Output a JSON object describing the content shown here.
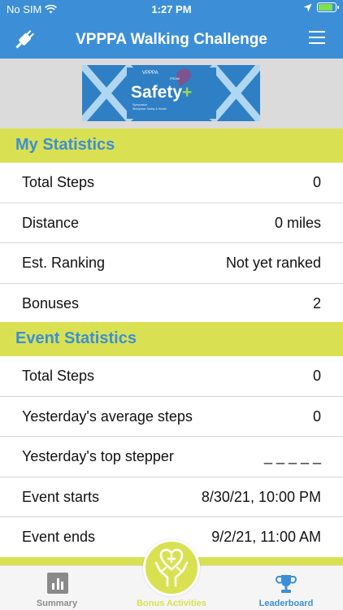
{
  "status_bar": {
    "carrier": "No SIM",
    "time": "1:27 PM",
    "battery_level": 0.92,
    "icons": [
      "wifi-icon",
      "location-arrow-icon",
      "battery-charging-icon"
    ]
  },
  "nav": {
    "title": "VPPPA Walking Challenge",
    "left_icon": "plug-icon",
    "right_icon": "hamburger-menu-icon"
  },
  "banner": {
    "org": "VPPPA",
    "from": "FROM",
    "title": "Safety",
    "title_plus": "+",
    "tagline_1": "Symposium",
    "tagline_2": "Workplace Safety & Health"
  },
  "my_statistics": {
    "header": "My Statistics",
    "rows": [
      {
        "label": "Total Steps",
        "value": "0"
      },
      {
        "label": "Distance",
        "value": "0 miles"
      },
      {
        "label": "Est. Ranking",
        "value": "Not yet ranked"
      },
      {
        "label": "Bonuses",
        "value": "2"
      }
    ]
  },
  "event_statistics": {
    "header": "Event Statistics",
    "rows": [
      {
        "label": "Total Steps",
        "value": "0"
      },
      {
        "label": "Yesterday's average steps",
        "value": "0"
      },
      {
        "label": "Yesterday's top stepper",
        "value": "_ _ _ _ _"
      },
      {
        "label": "Event starts",
        "value": "8/30/21, 10:00 PM"
      },
      {
        "label": "Event ends",
        "value": "9/2/21, 11:00 AM"
      }
    ]
  },
  "tabs": [
    {
      "label": "Summary",
      "icon": "bar-chart-icon"
    },
    {
      "label": "Bonus Activities",
      "icon": "hands-heart-icon"
    },
    {
      "label": "Leaderboard",
      "icon": "trophy-icon"
    }
  ],
  "colors": {
    "primary_blue": "#3c8fd6",
    "accent_yellow_green": "#d9e152",
    "inactive_gray": "#8c8c8c"
  }
}
